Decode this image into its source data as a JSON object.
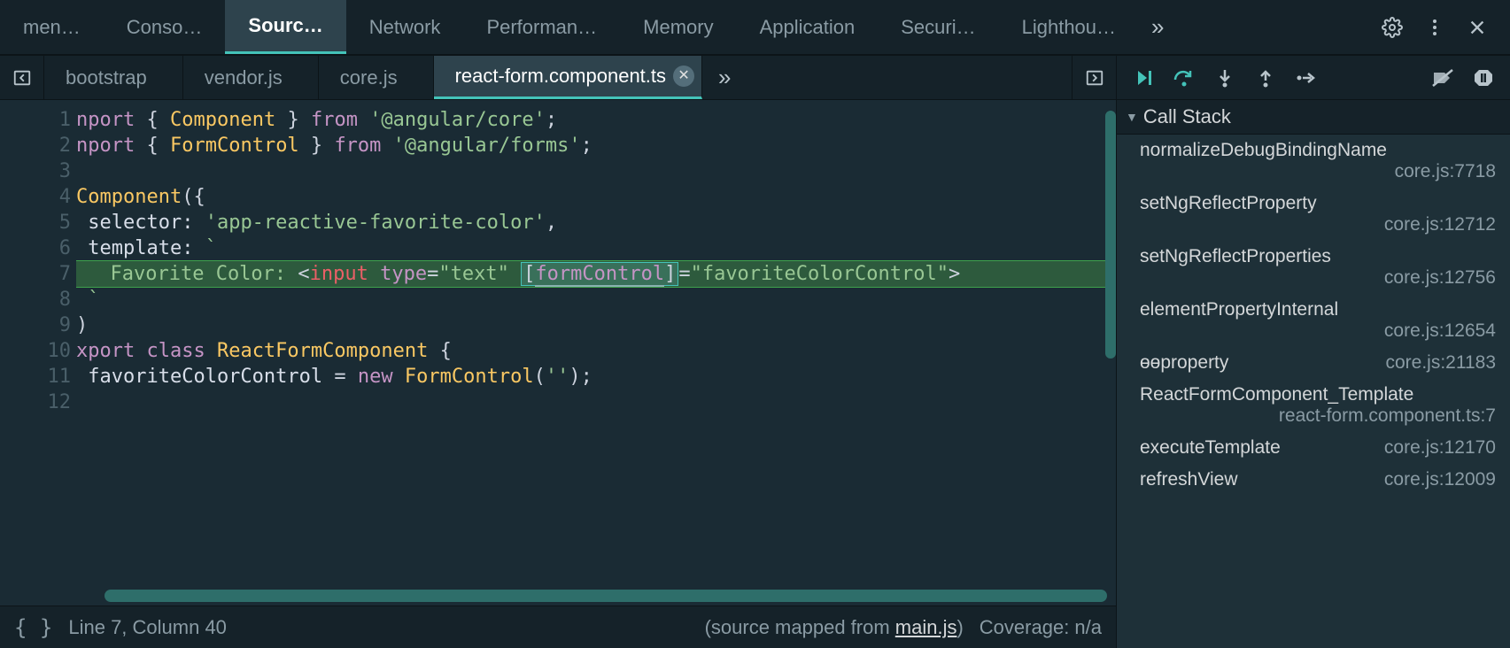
{
  "mainTabs": {
    "items": [
      {
        "label": "men"
      },
      {
        "label": "Conso"
      },
      {
        "label": "Sourc"
      },
      {
        "label": "Network"
      },
      {
        "label": "Performan"
      },
      {
        "label": "Memory"
      },
      {
        "label": "Application"
      },
      {
        "label": "Securi"
      },
      {
        "label": "Lighthou"
      }
    ],
    "activeIndex": 2
  },
  "fileTabs": {
    "items": [
      {
        "label": "bootstrap"
      },
      {
        "label": "vendor.js"
      },
      {
        "label": "core.js"
      },
      {
        "label": "react-form.component.ts"
      }
    ],
    "activeIndex": 3
  },
  "editor": {
    "lines": [
      [
        {
          "c": "tok-kw",
          "t": "nport "
        },
        {
          "c": "tok-punct",
          "t": "{ "
        },
        {
          "c": "tok-type",
          "t": "Component"
        },
        {
          "c": "tok-punct",
          "t": " } "
        },
        {
          "c": "tok-kw",
          "t": "from "
        },
        {
          "c": "tok-str",
          "t": "'@angular/core'"
        },
        {
          "c": "tok-punct",
          "t": ";"
        }
      ],
      [
        {
          "c": "tok-kw",
          "t": "nport "
        },
        {
          "c": "tok-punct",
          "t": "{ "
        },
        {
          "c": "tok-type",
          "t": "FormControl"
        },
        {
          "c": "tok-punct",
          "t": " } "
        },
        {
          "c": "tok-kw",
          "t": "from "
        },
        {
          "c": "tok-str",
          "t": "'@angular/forms'"
        },
        {
          "c": "tok-punct",
          "t": ";"
        }
      ],
      [],
      [
        {
          "c": "tok-type",
          "t": "Component"
        },
        {
          "c": "tok-punct",
          "t": "({"
        }
      ],
      [
        {
          "c": "tok-text",
          "t": " selector: "
        },
        {
          "c": "tok-str",
          "t": "'app-reactive-favorite-color'"
        },
        {
          "c": "tok-punct",
          "t": ","
        }
      ],
      [
        {
          "c": "tok-text",
          "t": " template: "
        },
        {
          "c": "tok-str",
          "t": "`"
        }
      ],
      [
        {
          "hl": true
        },
        {
          "c": "tok-str",
          "t": "  Favorite Color: "
        },
        {
          "c": "tok-punct",
          "t": "<"
        },
        {
          "c": "tok-attr",
          "t": "input"
        },
        {
          "c": "tok-text",
          "t": " "
        },
        {
          "c": "tok-kw",
          "t": "type"
        },
        {
          "c": "tok-punct",
          "t": "="
        },
        {
          "c": "tok-str",
          "t": "\"text\""
        },
        {
          "c": "tok-text",
          "t": " "
        },
        {
          "hl2": true,
          "children": [
            {
              "c": "tok-punct",
              "t": "["
            },
            {
              "c": "tok-kw tok-ul",
              "t": "formControl"
            },
            {
              "c": "tok-punct",
              "t": "]"
            }
          ]
        },
        {
          "c": "tok-punct",
          "t": "="
        },
        {
          "c": "tok-str",
          "t": "\"favoriteColorControl\""
        },
        {
          "c": "tok-punct",
          "t": ">"
        }
      ],
      [
        {
          "c": "tok-str",
          "t": " `"
        }
      ],
      [
        {
          "c": "tok-punct",
          "t": ")"
        }
      ],
      [
        {
          "c": "tok-kw",
          "t": "xport class "
        },
        {
          "c": "tok-type",
          "t": "ReactFormComponent"
        },
        {
          "c": "tok-punct",
          "t": " {"
        }
      ],
      [
        {
          "c": "tok-text",
          "t": " favoriteColorControl "
        },
        {
          "c": "tok-punct",
          "t": "= "
        },
        {
          "c": "tok-kw",
          "t": "new "
        },
        {
          "c": "tok-type",
          "t": "FormControl"
        },
        {
          "c": "tok-punct",
          "t": "("
        },
        {
          "c": "tok-str",
          "t": "''"
        },
        {
          "c": "tok-punct",
          "t": ");"
        }
      ],
      []
    ],
    "highlightLine": 7
  },
  "status": {
    "braces": "{ }",
    "position": "Line 7, Column 40",
    "sourceMappedPrefix": "(source mapped from ",
    "sourceMappedFile": "main.js",
    "sourceMappedSuffix": ")",
    "coverage": "Coverage: n/a"
  },
  "debugger": {
    "callStackTitle": "Call Stack",
    "frames": [
      {
        "fn": "normalizeDebugBindingName",
        "loc": "core.js:7718",
        "two": true
      },
      {
        "fn": "setNgReflectProperty",
        "loc": "core.js:12712",
        "two": true
      },
      {
        "fn": "setNgReflectProperties",
        "loc": "core.js:12756",
        "two": true
      },
      {
        "fn": "elementPropertyInternal",
        "loc": "core.js:12654",
        "two": true
      },
      {
        "fn": "ɵɵproperty",
        "loc": "core.js:21183",
        "two": false
      },
      {
        "fn": "ReactFormComponent_Template",
        "loc": "react-form.component.ts:7",
        "two": true
      },
      {
        "fn": "executeTemplate",
        "loc": "core.js:12170",
        "two": false
      },
      {
        "fn": "refreshView",
        "loc": "core.js:12009",
        "two": false
      }
    ]
  }
}
